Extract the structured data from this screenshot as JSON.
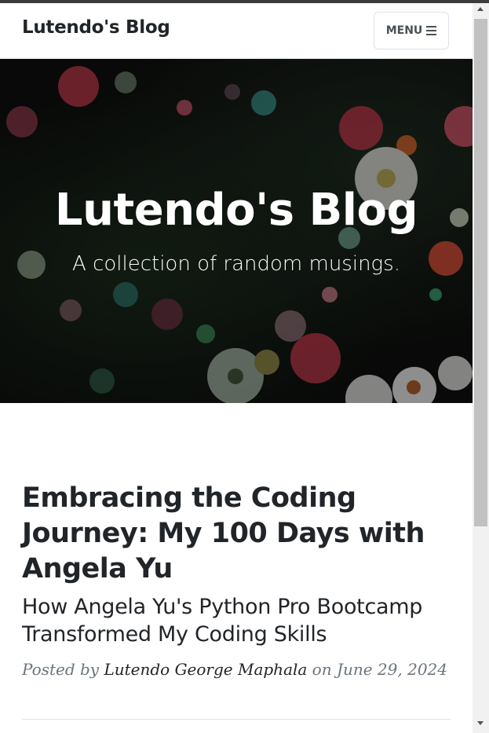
{
  "navbar": {
    "brand": "Lutendo's Blog",
    "menu_label": "MENU",
    "menu_icon": "hamburger-icon"
  },
  "hero": {
    "title": "Lutendo's Blog",
    "subtitle": "A collection of random musings.",
    "background": "dark floral photograph (sea anemones / flowers)"
  },
  "post": {
    "title": "Embracing the Coding Journey: My 100 Days with Angela Yu",
    "subtitle": "How Angela Yu's Python Pro Bootcamp Transformed My Coding Skills",
    "meta_prefix": "Posted by",
    "author": "Lutendo George Maphala",
    "meta_on": "on",
    "date": "June 29, 2024"
  },
  "colors": {
    "text_dark": "#212529",
    "text_muted": "#6c757d",
    "hero_dark": "#0d0f0d"
  }
}
